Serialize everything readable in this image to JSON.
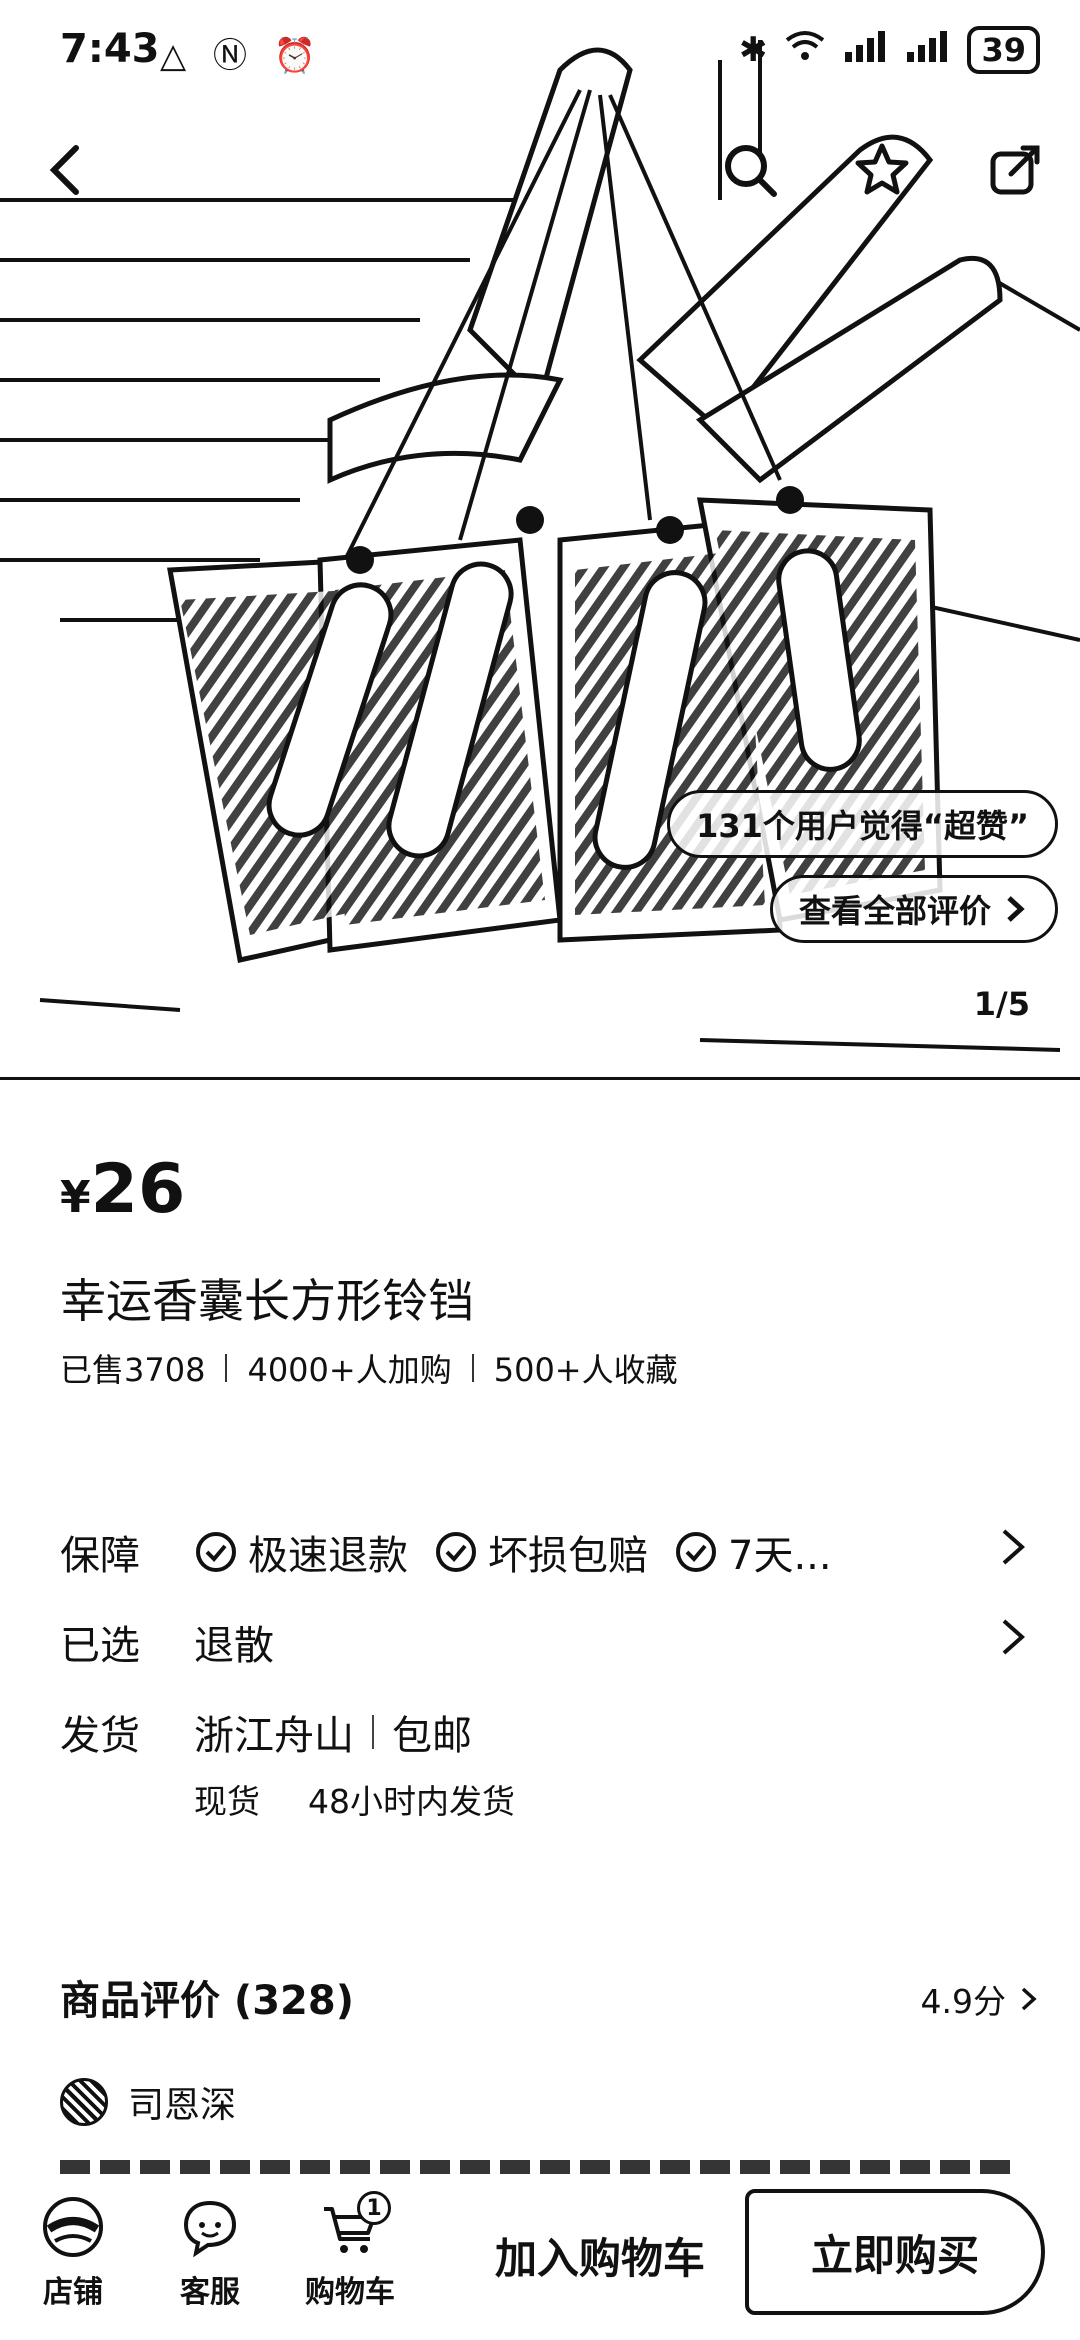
{
  "status_bar": {
    "time": "7:43",
    "battery": "39"
  },
  "hero": {
    "review_highlight": "131个用户觉得“超赞”",
    "view_all_reviews": "查看全部评价",
    "pager": "1/5"
  },
  "product": {
    "currency": "¥",
    "price": "26",
    "title": "幸运香囊长方形铃铛",
    "stats": [
      "已售3708",
      "4000+人加购",
      "500+人收藏"
    ]
  },
  "guarantee": {
    "label": "保障",
    "items": [
      "极速退款",
      "坏损包赔",
      "7天..."
    ]
  },
  "selected": {
    "label": "已选",
    "value": "退散"
  },
  "shipping": {
    "label": "发货",
    "origin": "浙江舟山",
    "fee": "包邮",
    "stock": "现货",
    "time": "48小时内发货"
  },
  "reviews": {
    "title": "商品评价 (328)",
    "score": "4.9分",
    "first_reviewer": "司恩深"
  },
  "bottom_bar": {
    "shop": "店铺",
    "service": "客服",
    "cart": "购物车",
    "cart_count": "1",
    "add_to_cart": "加入购物车",
    "buy_now": "立即购买"
  }
}
